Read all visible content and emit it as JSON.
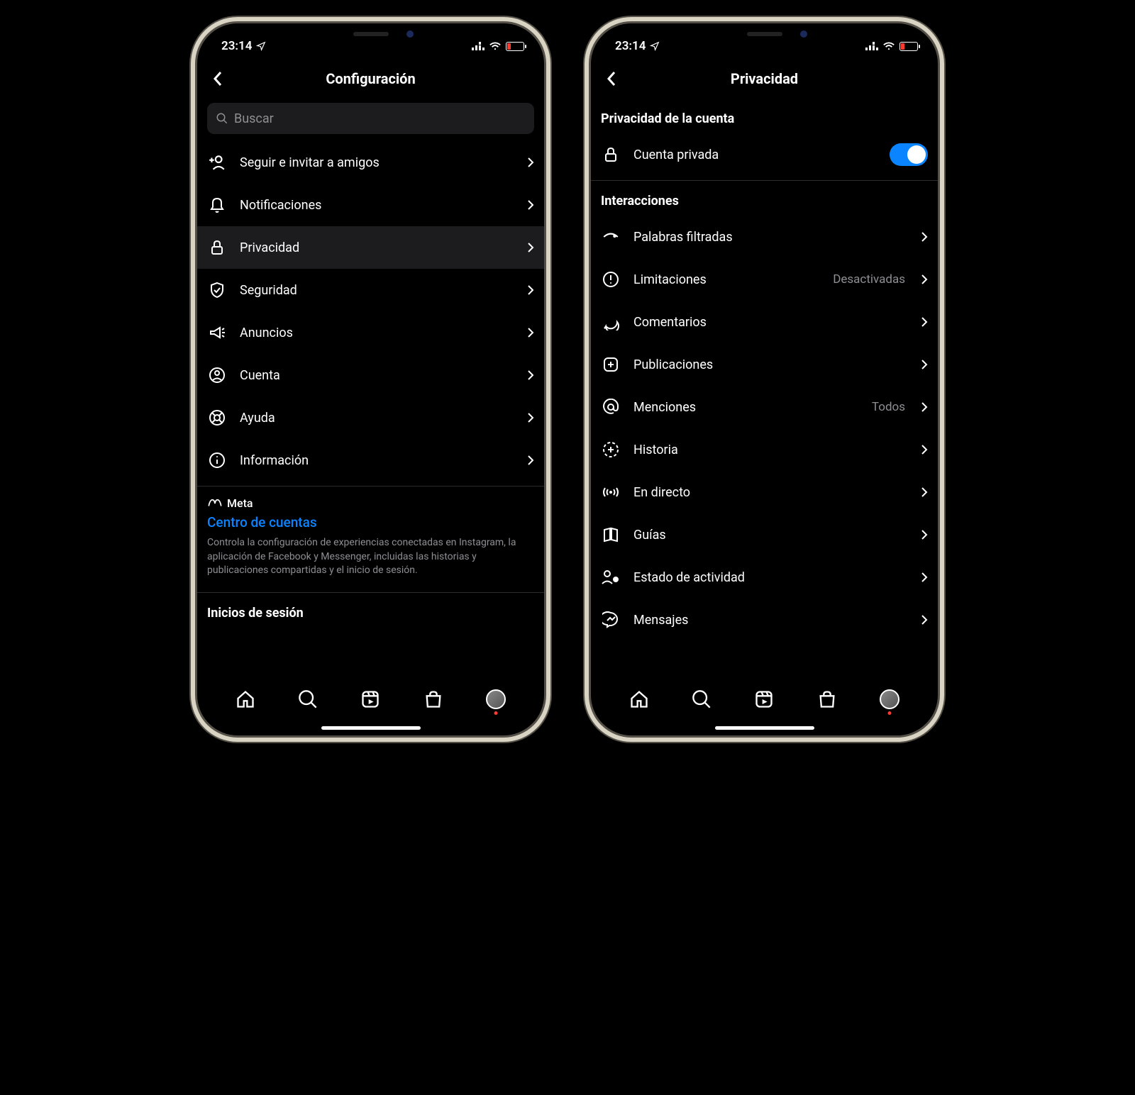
{
  "statusbar": {
    "time": "23:14"
  },
  "left": {
    "title": "Configuración",
    "search_placeholder": "Buscar",
    "items": [
      {
        "label": "Seguir e invitar a amigos"
      },
      {
        "label": "Notificaciones"
      },
      {
        "label": "Privacidad"
      },
      {
        "label": "Seguridad"
      },
      {
        "label": "Anuncios"
      },
      {
        "label": "Cuenta"
      },
      {
        "label": "Ayuda"
      },
      {
        "label": "Información"
      }
    ],
    "meta_brand": "Meta",
    "accounts_center": "Centro de cuentas",
    "accounts_desc": "Controla la configuración de experiencias conectadas en Instagram, la aplicación de Facebook y Messenger, incluidas las historias y publicaciones compartidas y el inicio de sesión.",
    "logins_header": "Inicios de sesión"
  },
  "right": {
    "title": "Privacidad",
    "section_privacy": "Privacidad de la cuenta",
    "private_account": "Cuenta privada",
    "private_account_on": true,
    "section_interactions": "Interacciones",
    "items": [
      {
        "label": "Palabras filtradas",
        "value": ""
      },
      {
        "label": "Limitaciones",
        "value": "Desactivadas"
      },
      {
        "label": "Comentarios",
        "value": ""
      },
      {
        "label": "Publicaciones",
        "value": ""
      },
      {
        "label": "Menciones",
        "value": "Todos"
      },
      {
        "label": "Historia",
        "value": ""
      },
      {
        "label": "En directo",
        "value": ""
      },
      {
        "label": "Guías",
        "value": ""
      },
      {
        "label": "Estado de actividad",
        "value": ""
      },
      {
        "label": "Mensajes",
        "value": ""
      }
    ]
  }
}
